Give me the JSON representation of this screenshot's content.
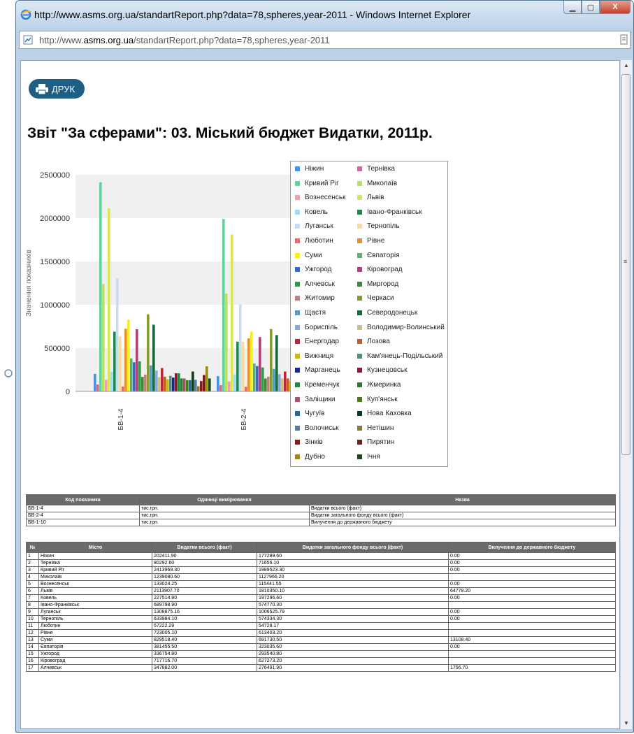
{
  "window": {
    "title": "http://www.asms.org.ua/standartReport.php?data=78,spheres,year-2011 - Windows Internet Explorer",
    "address_prefix": "http://www.",
    "address_host": "asms.org.ua",
    "address_path": "/standartReport.php?data=78,spheres,year-2011",
    "minimize_glyph": "▁",
    "maximize_glyph": "▢",
    "close_glyph": "X",
    "side_icon": "page-icon"
  },
  "toolbar": {
    "print_label": "ДРУК",
    "print_icon": "printer-icon"
  },
  "report": {
    "title": "Звіт \"За сферами\": 03. Міський бюджет Видатки, 2011р."
  },
  "chart_data": {
    "type": "bar",
    "ylabel": "Значення показників",
    "ylim": [
      0,
      2500000
    ],
    "yticks": [
      "0",
      "500000",
      "1000000",
      "1500000",
      "2000000",
      "2500000"
    ],
    "categories": [
      "БВ-1-4",
      "БВ-2-4"
    ],
    "grid": "horizontal bands",
    "legend_position": "right",
    "cities": [
      "Ніжин",
      "Тернівка",
      "Кривий Ріг",
      "Миколаїв",
      "Вознесенськ",
      "Львів",
      "Ковель",
      "Івано-Франківськ",
      "Луганськ",
      "Тернопіль",
      "Люботин",
      "Рівне",
      "Суми",
      "Євпаторія",
      "Ужгород",
      "Кіровоград",
      "Алчевськ",
      "Миргород",
      "Житомир",
      "Черкаси",
      "Щастя",
      "Северодонецьк",
      "Бориспіль",
      "Володимир-Волинський",
      "Енергодар",
      "Лозова",
      "Вижниця",
      "Кам'янець-Подільський",
      "Марганець",
      "Кузнецовськ",
      "Кременчук",
      "Жмеринка",
      "Заліщики",
      "Куп'янськ",
      "Чугуїв",
      "Нова Каховка",
      "Волочиськ",
      "Нетішин",
      "Зінків",
      "Пирятин",
      "Дубно",
      "Ічня"
    ],
    "colors": [
      "#4a90e2",
      "#d4669c",
      "#5fd39b",
      "#b8e066",
      "#f0a0a8",
      "#d8e84e",
      "#a8d8f0",
      "#1a8a4e",
      "#c8dcf0",
      "#f5dca0",
      "#e86a6a",
      "#e8902c",
      "#f0f020",
      "#6aa878",
      "#3a6ab8",
      "#b0407a",
      "#2f9a48",
      "#3a8a3a",
      "#c08080",
      "#8a9a2a",
      "#5a9aba",
      "#166a3a",
      "#8aa8d8",
      "#c8c088",
      "#b8283a",
      "#c06020",
      "#c8b818",
      "#5a8a7a",
      "#1a2a7a",
      "#8a1a3a",
      "#1f8a3a",
      "#2f7a2f",
      "#9a5a6a",
      "#4a7a1a",
      "#2a6a8a",
      "#0f3a1a",
      "#5a7a9a",
      "#8a7a3a",
      "#8a1a1a",
      "#7a1a1a",
      "#9a8a1a",
      "#1a4a1a"
    ],
    "series": [
      {
        "name": "БВ-1-4",
        "values": [
          202411.9,
          80292.6,
          2413969.3,
          1239080.6,
          133024.25,
          2113907.7,
          227514.8,
          689798.9,
          1308875.16,
          633984.1,
          57222.29,
          723005.1,
          829518.4,
          381455.5,
          336754.8,
          717716.7,
          347882,
          168000,
          195000,
          890000,
          300000,
          770000,
          240000,
          165000,
          270000,
          170000,
          140000,
          180000,
          160000,
          210000,
          210000,
          150000,
          150000,
          130000,
          130000,
          230000,
          135000,
          60000,
          120000,
          190000,
          290000,
          150000
        ]
      },
      {
        "name": "БВ-2-4",
        "values": [
          177289.6,
          71656.1,
          1989523.3,
          1127966.2,
          115441.55,
          1810350.1,
          197296.6,
          574770.3,
          1006525.79,
          574334.3,
          54728.17,
          613403.2,
          691730.5,
          323035.6,
          293540.8,
          627273.2,
          276491.9,
          150000,
          170000,
          720000,
          260000,
          650000,
          200000,
          150000,
          230000,
          150000,
          120000,
          150000,
          140000,
          180000,
          180000,
          130000,
          130000,
          110000,
          110000,
          200000,
          120000,
          50000,
          100000,
          160000,
          250000,
          130000
        ]
      }
    ]
  },
  "indicators_table": {
    "headers": [
      "Код показника",
      "Одиниці вимірювання",
      "Назва"
    ],
    "rows": [
      [
        "БВ-1-4",
        "тис.грн.",
        "Видатки всього (факт)"
      ],
      [
        "БВ-2-4",
        "тис.грн.",
        "Видатки загального фонду всього (факт)"
      ],
      [
        "БВ-1-10",
        "тис.грн.",
        "Вилучення до державного бюджету"
      ]
    ]
  },
  "data_table": {
    "headers": [
      "№",
      "Місто",
      "Видатки всього (факт)",
      "Видатки загального фонду всього (факт)",
      "Вилучення до державного бюджету"
    ],
    "rows": [
      [
        "1",
        "Ніжин",
        "202411.90",
        "177289.60",
        "0.00"
      ],
      [
        "2",
        "Тернівка",
        "80292.60",
        "71656.10",
        "0.00"
      ],
      [
        "3",
        "Кривий Ріг",
        "2413969.30",
        "1989523.30",
        "0.00"
      ],
      [
        "4",
        "Миколаїв",
        "1239080.60",
        "1127966.20",
        ""
      ],
      [
        "5",
        "Вознесенськ",
        "133024.25",
        "115441.55",
        "0.00"
      ],
      [
        "6",
        "Львів",
        "2113907.70",
        "1810350.10",
        "64778.20"
      ],
      [
        "7",
        "Ковель",
        "227514.80",
        "197296.60",
        "0.00"
      ],
      [
        "8",
        "Івано-Франківськ",
        "689798.90",
        "574770.30",
        ""
      ],
      [
        "9",
        "Луганськ",
        "1308875.16",
        "1006525.79",
        "0.00"
      ],
      [
        "10",
        "Тернопіль",
        "633984.10",
        "574334.30",
        "0.00"
      ],
      [
        "11",
        "Люботин",
        "57222.29",
        "54728.17",
        ""
      ],
      [
        "12",
        "Рівне",
        "723005.10",
        "613403.20",
        ""
      ],
      [
        "13",
        "Суми",
        "829518.40",
        "691730.50",
        "13108.40"
      ],
      [
        "14",
        "Євпаторія",
        "381455.50",
        "323035.60",
        "0.00"
      ],
      [
        "15",
        "Ужгород",
        "336754.80",
        "293540.80",
        ""
      ],
      [
        "16",
        "Кіровоград",
        "717716.70",
        "627273.20",
        ""
      ],
      [
        "17",
        "Алчевськ",
        "347882.00",
        "276491.90",
        "1756.70"
      ]
    ]
  }
}
